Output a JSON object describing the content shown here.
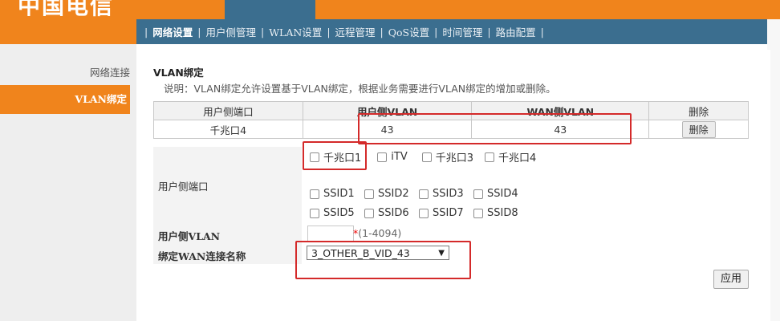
{
  "header": {
    "logo_text": "中国电信"
  },
  "nav": {
    "items": [
      "网络设置",
      "用户侧管理",
      "WLAN设置",
      "远程管理",
      "QoS设置",
      "时间管理",
      "路由配置"
    ],
    "active_index": 0,
    "separator": "|"
  },
  "sidebar": {
    "items": [
      "网络连接",
      "VLAN绑定"
    ],
    "active_index": 1
  },
  "section": {
    "title": "VLAN绑定",
    "description": "说明：VLAN绑定允许设置基于VLAN绑定，根据业务需要进行VLAN绑定的增加或删除。"
  },
  "binding_table": {
    "headers": [
      "用户侧端口",
      "用户侧VLAN",
      "WAN侧VLAN",
      "删除"
    ],
    "rows": [
      {
        "port": "千兆口4",
        "user_vlan": "43",
        "wan_vlan": "43",
        "delete_label": "删除"
      }
    ]
  },
  "form": {
    "port_label": "用户侧端口",
    "ports_row1": [
      "千兆口1",
      "iTV",
      "千兆口3",
      "千兆口4"
    ],
    "ssids_row1": [
      "SSID1",
      "SSID2",
      "SSID3",
      "SSID4"
    ],
    "ssids_row2": [
      "SSID5",
      "SSID6",
      "SSID7",
      "SSID8"
    ],
    "vlan_label": "用户侧VLAN",
    "vlan_value": "",
    "vlan_hint_star": "*",
    "vlan_hint": "(1-4094)",
    "wan_label": "绑定WAN连接名称",
    "wan_selected": "3_OTHER_B_VID_43",
    "select_arrow": "▼",
    "apply_label": "应用"
  },
  "colors": {
    "orange": "#f0841c",
    "blue": "#3b6e8f",
    "highlight": "#d42a2a"
  }
}
